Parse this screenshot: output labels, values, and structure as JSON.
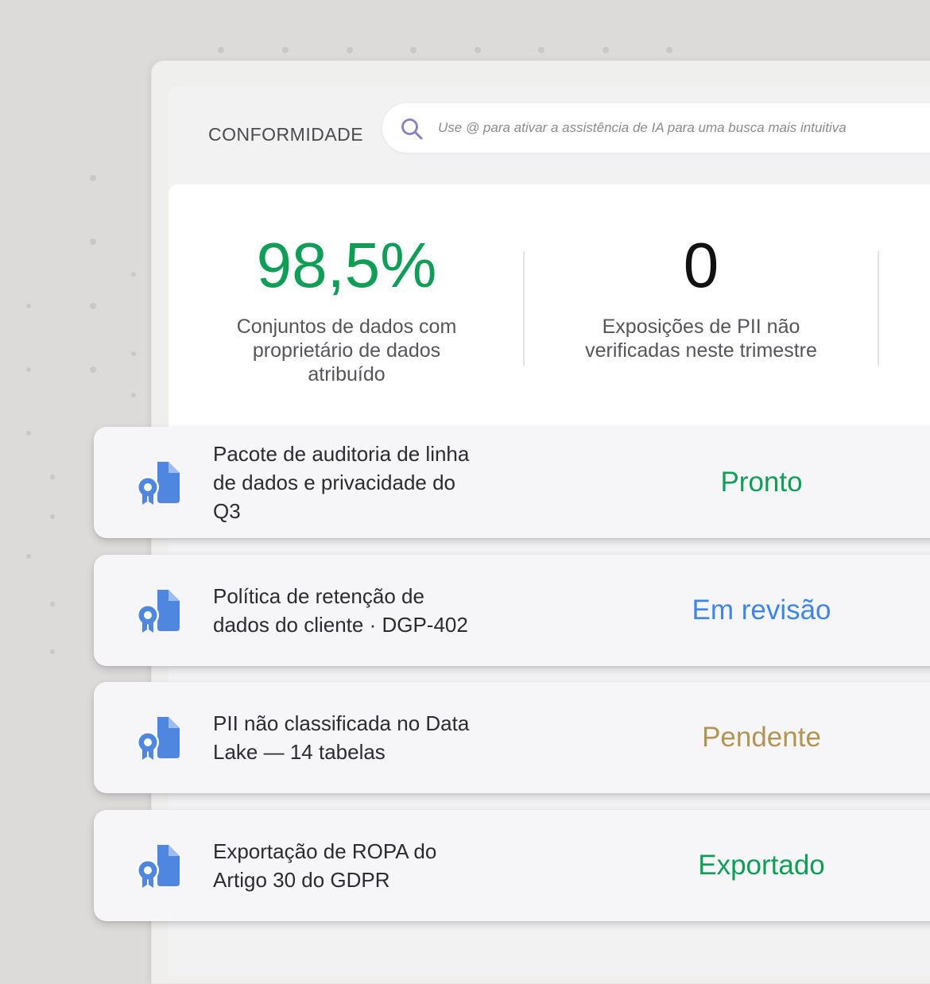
{
  "section_label": "CONFORMIDADE",
  "search": {
    "placeholder": "Use @ para ativar a assistência de IA para uma busca mais intuitiva",
    "icon": "search-icon"
  },
  "stats": [
    {
      "value": "98,5%",
      "label": "Conjuntos de dados com proprietário de dados atribuído",
      "color": "#0f9e56"
    },
    {
      "value": "0",
      "label": "Exposições de PII não verificadas neste trimestre",
      "color": "#111111"
    }
  ],
  "items": [
    {
      "title": "Pacote de auditoria de linha de dados e privacidade do Q3",
      "status": "Pronto",
      "status_color": "#0f9e56",
      "icon": "certificate-document-icon"
    },
    {
      "title": "Política de retenção de dados do cliente · DGP-402",
      "status": "Em revisão",
      "status_color": "#3d86e8",
      "icon": "certificate-document-icon"
    },
    {
      "title": "PII não classificada no Data Lake — 14 tabelas",
      "status": "Pendente",
      "status_color": "#b39553",
      "icon": "certificate-document-icon"
    },
    {
      "title": "Exportação de ROPA do Artigo 30 do GDPR",
      "status": "Exportado",
      "status_color": "#0f9e56",
      "icon": "certificate-document-icon"
    }
  ]
}
